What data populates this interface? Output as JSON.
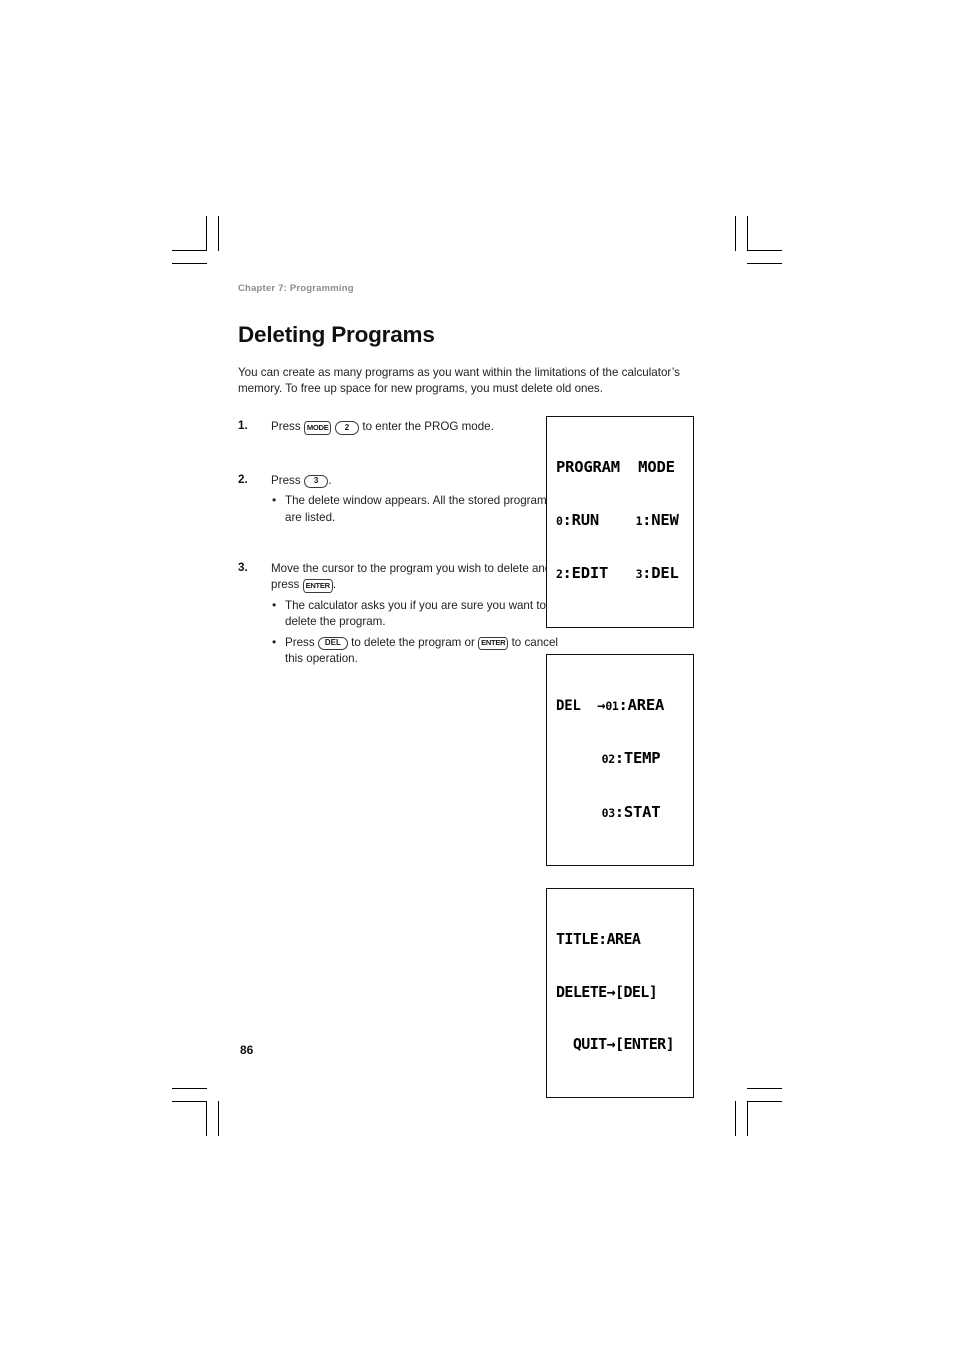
{
  "running_head": "Chapter 7: Programming",
  "page_title": "Deleting Programs",
  "intro": "You can create as many programs as you want within the limitations of the calculator’s memory. To free up space for new programs, you must delete old ones.",
  "page_number": "86",
  "steps": [
    {
      "number": "1.",
      "text_before": "Press",
      "key1": "MODE",
      "key2": "2",
      "text_after": "to enter the PROG mode.",
      "bullets": []
    },
    {
      "number": "2.",
      "text_before": "Press",
      "key1": "3",
      "text_after": ".",
      "bullets": [
        "The delete window appears. All the stored programs are listed."
      ]
    },
    {
      "number": "3.",
      "text_before": "Move the cursor to the program you wish to delete and press",
      "key1": "ENTER",
      "text_after": ".",
      "bullets": [
        "The calculator asks you if you are sure you want to delete the program."
      ],
      "bullet_key_press": "Press",
      "bullet_key1": "DEL",
      "bullet_key_mid": "to delete the program or",
      "bullet_key2": "ENTER",
      "bullet_key_end": "to cancel this operation."
    }
  ],
  "lcd_displays": [
    {
      "name": "program-mode-screen",
      "line1": "PROGRAM  MODE",
      "line2_a": "0",
      "line2_b": ":RUN    ",
      "line2_c": "1",
      "line2_d": ":NEW",
      "line3_a": "2",
      "line3_b": ":EDIT   ",
      "line3_c": "3",
      "line3_d": ":DEL"
    },
    {
      "name": "delete-list-screen",
      "line1_a": "DEL  →",
      "line1_b": "01",
      "line1_c": ":AREA",
      "line2_a": "     ",
      "line2_b": "02",
      "line2_c": ":TEMP",
      "line3_a": "     ",
      "line3_b": "03",
      "line3_c": ":STAT"
    },
    {
      "name": "delete-confirm-screen",
      "line1": "TITLE:AREA",
      "line2": "DELETE→[DEL]",
      "line3": "  QUIT→[ENTER]"
    }
  ]
}
